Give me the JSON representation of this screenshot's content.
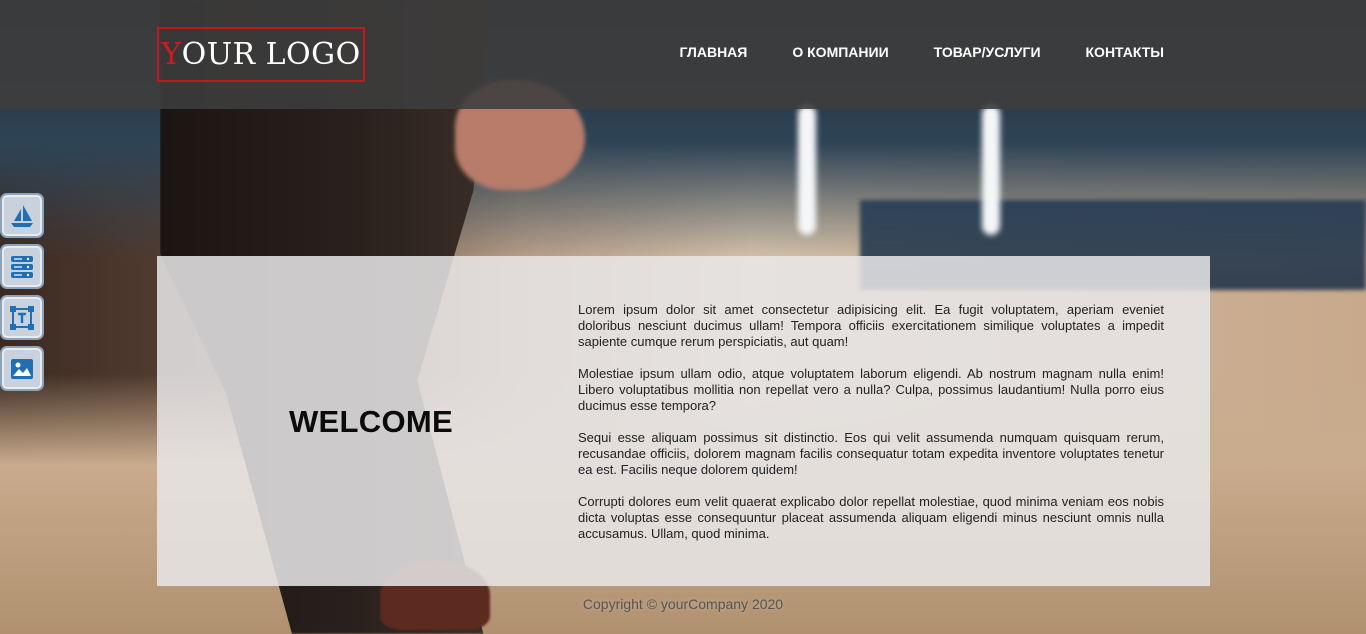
{
  "header": {
    "logo_first": "Y",
    "logo_rest": "OUR LOGO",
    "nav": [
      {
        "label": "ГЛАВНАЯ"
      },
      {
        "label": "О КОМПАНИИ"
      },
      {
        "label": "ТОВАР/УСЛУГИ"
      },
      {
        "label": "КОНТАКТЫ"
      }
    ]
  },
  "side_tools": [
    {
      "icon": "sailboat-icon"
    },
    {
      "icon": "server-icon"
    },
    {
      "icon": "text-box-icon"
    },
    {
      "icon": "image-icon"
    }
  ],
  "main": {
    "welcome": "WELCOME",
    "paragraphs": [
      "Lorem ipsum dolor sit amet consectetur adipisicing elit. Ea fugit voluptatem, aperiam eveniet doloribus nesciunt ducimus ullam! Tempora officiis exercitationem similique voluptates a impedit sapiente cumque rerum perspiciatis, aut quam!",
      "Molestiae ipsum ullam odio, atque voluptatem laborum eligendi. Ab nostrum magnam nulla enim! Libero voluptatibus mollitia non repellat vero a nulla? Culpa, possimus laudantium! Nulla porro eius ducimus esse tempora?",
      "Sequi esse aliquam possimus sit distinctio. Eos qui velit assumenda numquam quisquam rerum, recusandae officiis, dolorem magnam facilis consequatur totam expedita inventore voluptates tenetur ea est. Facilis neque dolorem quidem!",
      "Corrupti dolores eum velit quaerat explicabo dolor repellat molestiae, quod minima veniam eos nobis dicta voluptas esse consequuntur placeat assumenda aliquam eligendi minus nesciunt omnis nulla accusamus. Ullam, quod minima."
    ]
  },
  "footer": {
    "copyright": "Copyright © yourCompany 2020"
  },
  "colors": {
    "header_bg": "#3e3e3e",
    "logo_accent": "#d4181f",
    "icon_blue": "#1f6fb2"
  }
}
